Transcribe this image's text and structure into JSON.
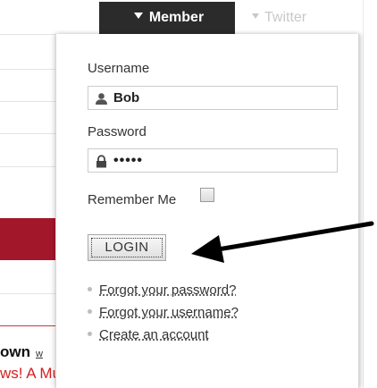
{
  "nav": {
    "member_tab": {
      "label": "Member",
      "icon": "caret-down-icon"
    },
    "twitter_tab": {
      "label": "Twitter",
      "icon": "caret-down-icon"
    }
  },
  "login_panel": {
    "username": {
      "label": "Username",
      "value": "Bob",
      "icon": "user-icon"
    },
    "password": {
      "label": "Password",
      "value": "•••••",
      "icon": "lock-icon"
    },
    "remember_me": {
      "label": "Remember Me",
      "checked": false
    },
    "login_button": {
      "label": "LOGIN"
    },
    "links": [
      {
        "label": "Forgot your password?"
      },
      {
        "label": "Forgot your username?"
      },
      {
        "label": "Create an account"
      }
    ]
  },
  "background_page": {
    "headline_fragment": "own",
    "headline_small": "w",
    "subhead_fragment": "ws! A Must for All Music"
  },
  "colors": {
    "member_tab_bg": "#2b2b2b",
    "accent_red": "#a3172b",
    "subhead_red": "#d42020",
    "annotation_arrow": "#000000"
  },
  "annotation": {
    "icon": "arrow-pointing-left-icon",
    "target": "login_button"
  }
}
